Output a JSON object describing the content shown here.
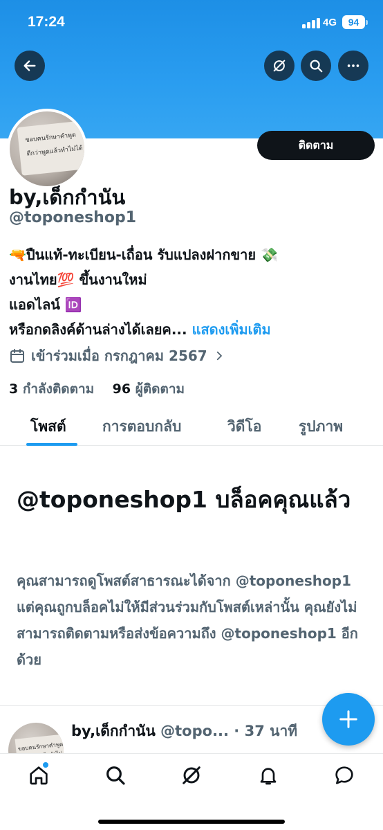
{
  "status_bar": {
    "time": "17:24",
    "network": "4G",
    "battery": "94"
  },
  "profile": {
    "follow_label": "ติดตาม",
    "display_name": "by,เด็กกำนัน",
    "handle": "@toponeshop1",
    "bio_lines": [
      "🔫ปืนแท้-ทะเบียน-เถื่อน รับแปลงฝากขาย 💸",
      "งานไทย💯 ขึ้นงานใหม่",
      "แอดไลน์ 🆔",
      "หรือกดลิงค์ด้านล่างได้เลยค..."
    ],
    "show_more": " แสดงเพิ่มเติม",
    "joined": "เข้าร่วมเมื่อ กรกฎาคม 2567",
    "following_count": "3",
    "following_label": " กำลังติดตาม",
    "followers_count": "96",
    "followers_label": " ผู้ติดตาม",
    "avatar_text": "ขอบคนรักษาคำพูด ดีกว่าพูดแล้วทำไม่ได้"
  },
  "tabs": [
    "โพสต์",
    "การตอบกลับ",
    "วิดีโอ",
    "รูปภาพ"
  ],
  "blocked": {
    "title": "@toponeshop1 บล็อคคุณแล้ว",
    "body": "คุณสามารถดูโพสต์สาธารณะได้จาก @toponeshop1 แต่คุณถูกบล็อคไม่ให้มีส่วนร่วมกับโพสต์เหล่านั้น คุณยังไม่สามารถติดตามหรือส่งข้อความถึง @toponeshop1 อีกด้วย"
  },
  "post": {
    "author": "by,เด็กกำนัน",
    "meta": " @topo... · 37 นาที"
  },
  "colors": {
    "accent": "#1d9bf0",
    "banner": "#2a9df0",
    "text": "#0f1419",
    "muted": "#536471"
  },
  "icons": {
    "header": [
      "back-arrow-icon",
      "grok-icon",
      "search-icon",
      "more-icon"
    ],
    "bottom_nav": [
      "home-icon",
      "search-icon",
      "grok-icon",
      "notifications-icon",
      "messages-icon"
    ],
    "fab": "plus-icon"
  }
}
